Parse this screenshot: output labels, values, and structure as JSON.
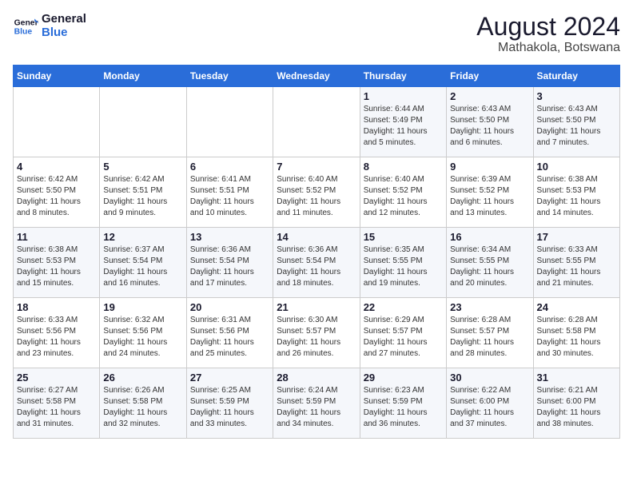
{
  "header": {
    "logo_general": "General",
    "logo_blue": "Blue",
    "month_year": "August 2024",
    "location": "Mathakola, Botswana"
  },
  "days_of_week": [
    "Sunday",
    "Monday",
    "Tuesday",
    "Wednesday",
    "Thursday",
    "Friday",
    "Saturday"
  ],
  "weeks": [
    [
      {
        "day": "",
        "info": ""
      },
      {
        "day": "",
        "info": ""
      },
      {
        "day": "",
        "info": ""
      },
      {
        "day": "",
        "info": ""
      },
      {
        "day": "1",
        "info": "Sunrise: 6:44 AM\nSunset: 5:49 PM\nDaylight: 11 hours\nand 5 minutes."
      },
      {
        "day": "2",
        "info": "Sunrise: 6:43 AM\nSunset: 5:50 PM\nDaylight: 11 hours\nand 6 minutes."
      },
      {
        "day": "3",
        "info": "Sunrise: 6:43 AM\nSunset: 5:50 PM\nDaylight: 11 hours\nand 7 minutes."
      }
    ],
    [
      {
        "day": "4",
        "info": "Sunrise: 6:42 AM\nSunset: 5:50 PM\nDaylight: 11 hours\nand 8 minutes."
      },
      {
        "day": "5",
        "info": "Sunrise: 6:42 AM\nSunset: 5:51 PM\nDaylight: 11 hours\nand 9 minutes."
      },
      {
        "day": "6",
        "info": "Sunrise: 6:41 AM\nSunset: 5:51 PM\nDaylight: 11 hours\nand 10 minutes."
      },
      {
        "day": "7",
        "info": "Sunrise: 6:40 AM\nSunset: 5:52 PM\nDaylight: 11 hours\nand 11 minutes."
      },
      {
        "day": "8",
        "info": "Sunrise: 6:40 AM\nSunset: 5:52 PM\nDaylight: 11 hours\nand 12 minutes."
      },
      {
        "day": "9",
        "info": "Sunrise: 6:39 AM\nSunset: 5:52 PM\nDaylight: 11 hours\nand 13 minutes."
      },
      {
        "day": "10",
        "info": "Sunrise: 6:38 AM\nSunset: 5:53 PM\nDaylight: 11 hours\nand 14 minutes."
      }
    ],
    [
      {
        "day": "11",
        "info": "Sunrise: 6:38 AM\nSunset: 5:53 PM\nDaylight: 11 hours\nand 15 minutes."
      },
      {
        "day": "12",
        "info": "Sunrise: 6:37 AM\nSunset: 5:54 PM\nDaylight: 11 hours\nand 16 minutes."
      },
      {
        "day": "13",
        "info": "Sunrise: 6:36 AM\nSunset: 5:54 PM\nDaylight: 11 hours\nand 17 minutes."
      },
      {
        "day": "14",
        "info": "Sunrise: 6:36 AM\nSunset: 5:54 PM\nDaylight: 11 hours\nand 18 minutes."
      },
      {
        "day": "15",
        "info": "Sunrise: 6:35 AM\nSunset: 5:55 PM\nDaylight: 11 hours\nand 19 minutes."
      },
      {
        "day": "16",
        "info": "Sunrise: 6:34 AM\nSunset: 5:55 PM\nDaylight: 11 hours\nand 20 minutes."
      },
      {
        "day": "17",
        "info": "Sunrise: 6:33 AM\nSunset: 5:55 PM\nDaylight: 11 hours\nand 21 minutes."
      }
    ],
    [
      {
        "day": "18",
        "info": "Sunrise: 6:33 AM\nSunset: 5:56 PM\nDaylight: 11 hours\nand 23 minutes."
      },
      {
        "day": "19",
        "info": "Sunrise: 6:32 AM\nSunset: 5:56 PM\nDaylight: 11 hours\nand 24 minutes."
      },
      {
        "day": "20",
        "info": "Sunrise: 6:31 AM\nSunset: 5:56 PM\nDaylight: 11 hours\nand 25 minutes."
      },
      {
        "day": "21",
        "info": "Sunrise: 6:30 AM\nSunset: 5:57 PM\nDaylight: 11 hours\nand 26 minutes."
      },
      {
        "day": "22",
        "info": "Sunrise: 6:29 AM\nSunset: 5:57 PM\nDaylight: 11 hours\nand 27 minutes."
      },
      {
        "day": "23",
        "info": "Sunrise: 6:28 AM\nSunset: 5:57 PM\nDaylight: 11 hours\nand 28 minutes."
      },
      {
        "day": "24",
        "info": "Sunrise: 6:28 AM\nSunset: 5:58 PM\nDaylight: 11 hours\nand 30 minutes."
      }
    ],
    [
      {
        "day": "25",
        "info": "Sunrise: 6:27 AM\nSunset: 5:58 PM\nDaylight: 11 hours\nand 31 minutes."
      },
      {
        "day": "26",
        "info": "Sunrise: 6:26 AM\nSunset: 5:58 PM\nDaylight: 11 hours\nand 32 minutes."
      },
      {
        "day": "27",
        "info": "Sunrise: 6:25 AM\nSunset: 5:59 PM\nDaylight: 11 hours\nand 33 minutes."
      },
      {
        "day": "28",
        "info": "Sunrise: 6:24 AM\nSunset: 5:59 PM\nDaylight: 11 hours\nand 34 minutes."
      },
      {
        "day": "29",
        "info": "Sunrise: 6:23 AM\nSunset: 5:59 PM\nDaylight: 11 hours\nand 36 minutes."
      },
      {
        "day": "30",
        "info": "Sunrise: 6:22 AM\nSunset: 6:00 PM\nDaylight: 11 hours\nand 37 minutes."
      },
      {
        "day": "31",
        "info": "Sunrise: 6:21 AM\nSunset: 6:00 PM\nDaylight: 11 hours\nand 38 minutes."
      }
    ]
  ]
}
